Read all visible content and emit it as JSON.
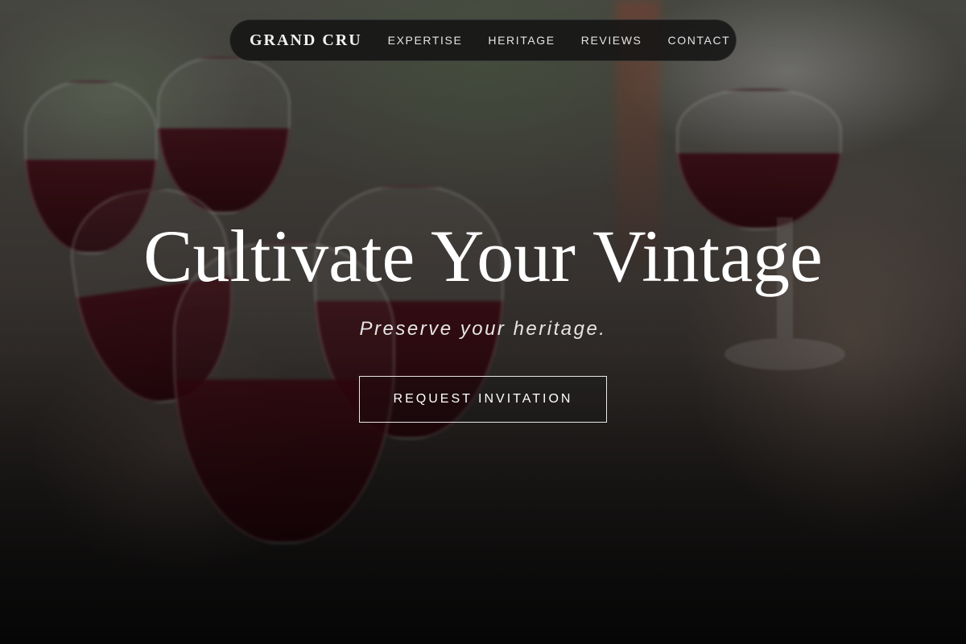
{
  "nav": {
    "brand": "GRAND CRU",
    "links": [
      {
        "label": "EXPERTISE"
      },
      {
        "label": "HERITAGE"
      },
      {
        "label": "REVIEWS"
      },
      {
        "label": "CONTACT"
      }
    ]
  },
  "hero": {
    "headline": "Cultivate Your Vintage",
    "subtitle": "Preserve your heritage.",
    "cta_label": "REQUEST INVITATION",
    "background_image": "people toasting with red wine glasses"
  }
}
